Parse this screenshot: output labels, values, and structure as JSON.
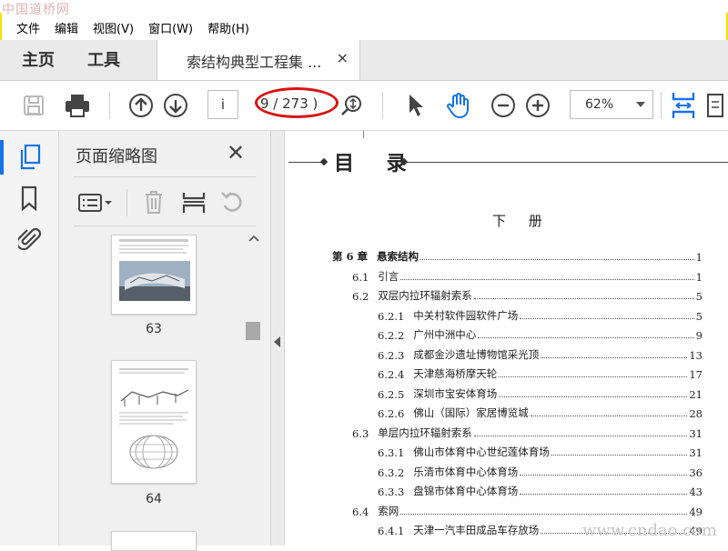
{
  "watermark_top": "中国道桥网",
  "watermark_bottom": "www.cndao.com",
  "menu": [
    "文件",
    "编辑",
    "视图(V)",
    "窗口(W)",
    "帮助(H)"
  ],
  "tabs": {
    "home": "主页",
    "tools": "工具",
    "document": "索结构典型工程集 ...",
    "close": "×"
  },
  "toolbar": {
    "page_input": "i",
    "page_count": "9 / 273 )",
    "zoom": "62%",
    "icons": [
      "save-icon",
      "print-icon",
      "arrow-up-icon",
      "arrow-down-icon",
      "search-zoom-icon",
      "select-cursor-icon",
      "hand-icon",
      "zoom-out-icon",
      "zoom-in-icon",
      "fit-page-icon"
    ]
  },
  "left_rail": {
    "icons": [
      "pages-icon",
      "bookmark-icon",
      "paperclip-icon"
    ]
  },
  "thumbnails_panel": {
    "title": "页面缩略图",
    "close": "✕",
    "pages": [
      "63",
      "64"
    ]
  },
  "document": {
    "toc_title": "目 录",
    "volume": "下 册",
    "entries": [
      {
        "num": "第 6 章",
        "title": "悬索结构",
        "page": "1",
        "level": 0
      },
      {
        "num": "6.1",
        "title": "引言",
        "page": "1",
        "level": 1
      },
      {
        "num": "6.2",
        "title": "双层内拉环辐射索系",
        "page": "5",
        "level": 1
      },
      {
        "num": "6.2.1",
        "title": "中关村软件园软件广场",
        "page": "5",
        "level": 2
      },
      {
        "num": "6.2.2",
        "title": "广州中洲中心",
        "page": "9",
        "level": 2
      },
      {
        "num": "6.2.3",
        "title": "成都金沙遗址博物馆采光顶",
        "page": "13",
        "level": 2
      },
      {
        "num": "6.2.4",
        "title": "天津慈海桥摩天轮",
        "page": "17",
        "level": 2
      },
      {
        "num": "6.2.5",
        "title": "深圳市宝安体育场",
        "page": "21",
        "level": 2
      },
      {
        "num": "6.2.6",
        "title": "佛山（国际）家居博览城",
        "page": "28",
        "level": 2
      },
      {
        "num": "6.3",
        "title": "单层内拉环辐射索系",
        "page": "31",
        "level": 1
      },
      {
        "num": "6.3.1",
        "title": "佛山市体育中心世纪莲体育场",
        "page": "31",
        "level": 2
      },
      {
        "num": "6.3.2",
        "title": "乐清市体育中心体育场",
        "page": "36",
        "level": 2
      },
      {
        "num": "6.3.3",
        "title": "盘锦市体育中心体育场",
        "page": "43",
        "level": 2
      },
      {
        "num": "6.4",
        "title": "索网",
        "page": "49",
        "level": 1
      },
      {
        "num": "6.4.1",
        "title": "天津一汽丰田成品车存放场",
        "page": "49",
        "level": 2
      }
    ]
  },
  "colors": {
    "accent": "#1473e6",
    "highlight_oval": "#d61414",
    "frame": "#f2e200"
  }
}
